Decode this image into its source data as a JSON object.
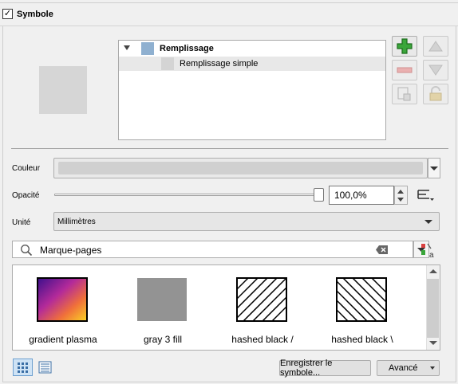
{
  "group": {
    "title": "Symbole",
    "checked": true
  },
  "layer_tree": {
    "items": [
      {
        "label": "Remplissage",
        "color": "#8fb0d0"
      },
      {
        "label": "Remplissage simple",
        "color": "#d4d4d4"
      }
    ]
  },
  "side_buttons": {
    "add": "add-layer-icon",
    "remove": "remove-layer-icon",
    "up": "arrow-up-icon",
    "down": "arrow-down-icon",
    "duplicate": "duplicate-icon",
    "lock": "lock-icon"
  },
  "color": {
    "label": "Couleur",
    "value": "#d0d0d0"
  },
  "opacity": {
    "label": "Opacité",
    "value": "100,0%",
    "fraction": 1.0
  },
  "unit": {
    "label": "Unité",
    "value": "Millimètres"
  },
  "search": {
    "value": "Marque-pages"
  },
  "symbols": [
    {
      "name": "gradient   plasma",
      "kind": "gradient"
    },
    {
      "name": "gray 3 fill",
      "kind": "gray"
    },
    {
      "name": "hashed black /",
      "kind": "hash-forward"
    },
    {
      "name": "hashed black \\",
      "kind": "hash-back"
    }
  ],
  "footer": {
    "save_label": "Enregistrer le symbole...",
    "advanced_label": "Avancé"
  }
}
